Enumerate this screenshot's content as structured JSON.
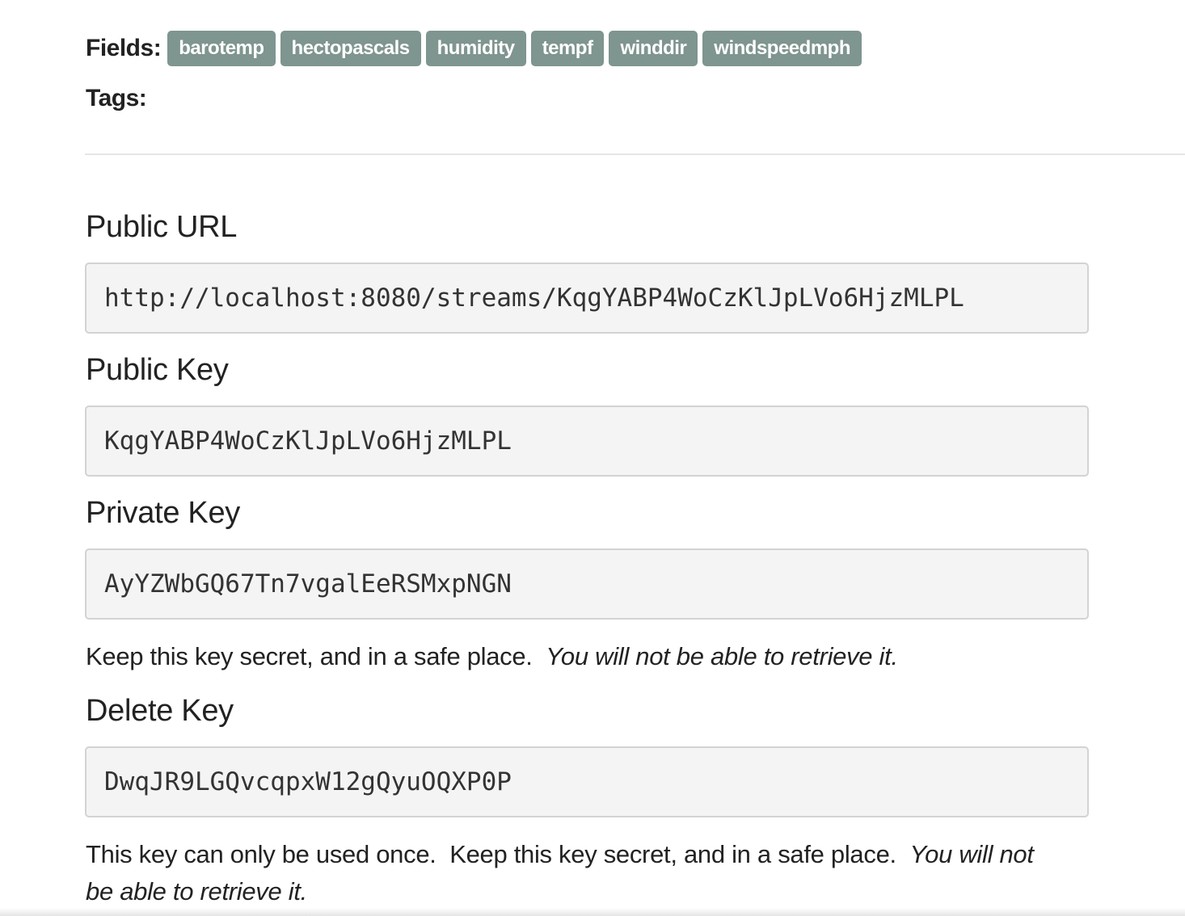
{
  "fields": {
    "label": "Fields:",
    "items": [
      "barotemp",
      "hectopascals",
      "humidity",
      "tempf",
      "winddir",
      "windspeedmph"
    ]
  },
  "tags": {
    "label": "Tags:"
  },
  "public_url": {
    "heading": "Public URL",
    "value": "http://localhost:8080/streams/KqgYABP4WoCzKlJpLVo6HjzMLPL"
  },
  "public_key": {
    "heading": "Public Key",
    "value": "KqgYABP4WoCzKlJpLVo6HjzMLPL"
  },
  "private_key": {
    "heading": "Private Key",
    "value": "AyYZWbGQ67Tn7vgalEeRSMxpNGN",
    "note_plain": "Keep this key secret, and in a safe place.",
    "note_italic": "You will not be able to retrieve it."
  },
  "delete_key": {
    "heading": "Delete Key",
    "value": "DwqJR9LGQvcqpxW12gQyuOQXP0P",
    "note_plain": "This key can only be used once.  Keep this key secret, and in a safe place.",
    "note_italic": "You will not be able to retrieve it."
  },
  "colors": {
    "badge_bg": "#7f958f",
    "box_bg": "#f4f4f4",
    "box_border": "#d3d3d3",
    "text": "#222222"
  }
}
